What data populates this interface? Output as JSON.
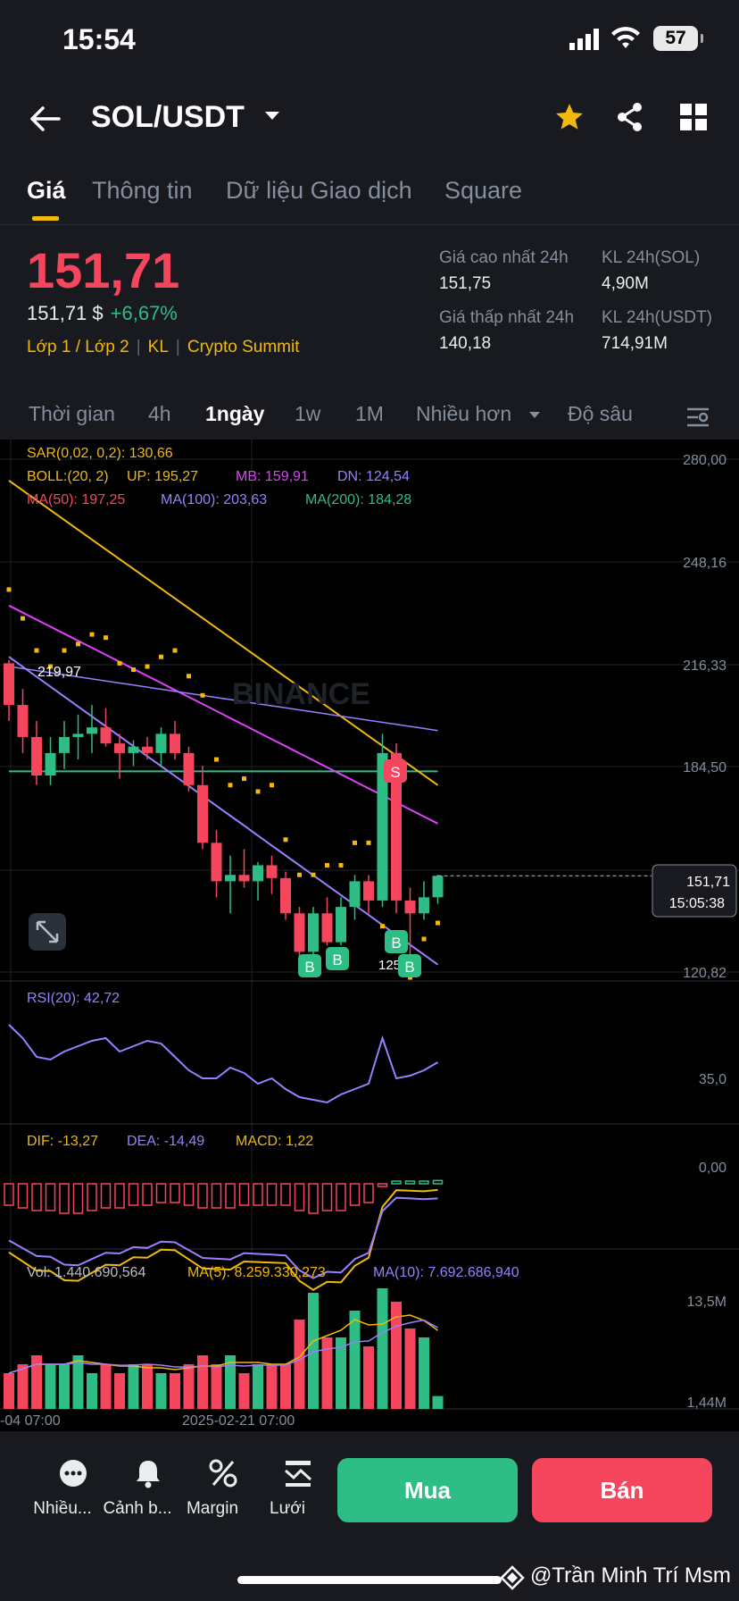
{
  "status_bar": {
    "time": "15:54",
    "battery": "57"
  },
  "header": {
    "pair": "SOL/USDT"
  },
  "tabs": [
    {
      "label": "Giá"
    },
    {
      "label": "Thông tin"
    },
    {
      "label": "Dữ liệu Giao dịch"
    },
    {
      "label": "Square"
    }
  ],
  "price": {
    "last": "151,71",
    "usd": "151,71 $",
    "change": "+6,67%",
    "tags": [
      "Lớp 1 / Lớp 2",
      "KL",
      "Crypto Summit"
    ]
  },
  "stats": {
    "high_label": "Giá cao nhất 24h",
    "high": "151,75",
    "low_label": "Giá thấp nhất 24h",
    "low": "140,18",
    "vol_sol_label": "KL 24h(SOL)",
    "vol_sol": "4,90M",
    "vol_usdt_label": "KL 24h(USDT)",
    "vol_usdt": "714,91M"
  },
  "intervals": {
    "items": [
      "Thời gian",
      "4h",
      "1ngày",
      "1w",
      "1M",
      "Nhiều hơn"
    ],
    "active": "1ngày",
    "depth": "Độ sâu"
  },
  "indicators": {
    "sar": "SAR(0,02, 0,2): 130,66",
    "boll": "BOLL:(20, 2)",
    "up": "UP: 195,27",
    "mb": "MB: 159,91",
    "dn": "DN: 124,54",
    "ma50": "MA(50): 197,25",
    "ma100": "MA(100): 203,63",
    "ma200": "MA(200): 184,28",
    "rsi": "RSI(20): 42,72",
    "dif": "DIF: -13,27",
    "dea": "DEA: -14,49",
    "macd": "MACD: 1,22",
    "vol": "Vol: 1.440.690,564",
    "vol_ma5": "MA(5): 8.259.330,273",
    "vol_ma10": "MA(10): 7.692.686,940"
  },
  "price_axis": [
    "280,00",
    "248,16",
    "216,33",
    "184,50",
    "120,82"
  ],
  "rsi_axis": "35,0",
  "macd_axis": "0,00",
  "vol_axis": [
    "13,5M",
    "1,44M"
  ],
  "current_price_tag": {
    "price": "151,71",
    "countdown": "15:05:38"
  },
  "markers": {
    "high_label": "219,97",
    "low_label": "125,55",
    "sell": "S",
    "buy": "B"
  },
  "date_axis": [
    "-04 07:00",
    "2025-02-21 07:00"
  ],
  "watermark_logo": "BINANCE",
  "bottom_bar": {
    "items": [
      "Nhiều...",
      "Cảnh b...",
      "Margin",
      "Lưới"
    ],
    "buy": "Mua",
    "sell": "Bán"
  },
  "credit": "@Trần Minh Trí Msm",
  "colors": {
    "up": "#2ebd85",
    "down": "#f6465d",
    "accent": "#f0b90b",
    "bg": "#181a20"
  },
  "chart_data": {
    "type": "candlestick",
    "candles_ohlc": [
      [
        218,
        219,
        200,
        205
      ],
      [
        205,
        210,
        190,
        195
      ],
      [
        195,
        200,
        180,
        183
      ],
      [
        183,
        195,
        180,
        190
      ],
      [
        190,
        200,
        185,
        195
      ],
      [
        195,
        202,
        188,
        196
      ],
      [
        196,
        205,
        190,
        198
      ],
      [
        198,
        204,
        192,
        193
      ],
      [
        193,
        196,
        182,
        190
      ],
      [
        190,
        194,
        186,
        192
      ],
      [
        192,
        195,
        188,
        190
      ],
      [
        190,
        198,
        186,
        196
      ],
      [
        196,
        200,
        188,
        190
      ],
      [
        190,
        192,
        178,
        180
      ],
      [
        180,
        186,
        160,
        162
      ],
      [
        162,
        166,
        145,
        150
      ],
      [
        150,
        158,
        140,
        152
      ],
      [
        152,
        160,
        148,
        150
      ],
      [
        150,
        156,
        144,
        155
      ],
      [
        155,
        158,
        146,
        151
      ],
      [
        151,
        153,
        138,
        140
      ],
      [
        140,
        142,
        125,
        128
      ],
      [
        128,
        142,
        126,
        140
      ],
      [
        140,
        145,
        130,
        131
      ],
      [
        131,
        145,
        130,
        142
      ],
      [
        142,
        152,
        138,
        150
      ],
      [
        150,
        152,
        140,
        144
      ],
      [
        144,
        196,
        142,
        190
      ],
      [
        190,
        193,
        140,
        144
      ],
      [
        144,
        148,
        126,
        140
      ],
      [
        140,
        150,
        138,
        145
      ],
      [
        145,
        152,
        143,
        151.71
      ]
    ],
    "rsi_values": [
      60,
      55,
      48,
      47,
      50,
      52,
      54,
      55,
      50,
      52,
      54,
      53,
      48,
      43,
      40,
      40,
      44,
      42,
      38,
      40,
      36,
      33,
      32,
      31,
      34,
      36,
      38,
      55,
      40,
      41,
      43,
      46
    ],
    "macd_hist": [
      -8,
      -9,
      -10,
      -10,
      -11,
      -11,
      -10,
      -9,
      -9,
      -8,
      -8,
      -7,
      -7,
      -8,
      -9,
      -9,
      -9,
      -8,
      -8,
      -8,
      -8,
      -10,
      -11,
      -10,
      -10,
      -8,
      -7,
      -1,
      1,
      1,
      1,
      1.22
    ],
    "volume_millions": [
      4,
      5,
      6,
      5,
      5,
      6,
      4,
      5,
      4,
      5,
      5,
      4,
      4,
      5,
      6,
      5,
      6,
      4,
      5,
      5,
      5,
      10,
      13,
      8,
      8,
      11,
      7,
      13.5,
      12,
      9,
      8,
      1.44
    ],
    "boll": {
      "up": 195.27,
      "mb": 159.91,
      "dn": 124.54
    },
    "ylim": [
      115,
      285
    ]
  }
}
